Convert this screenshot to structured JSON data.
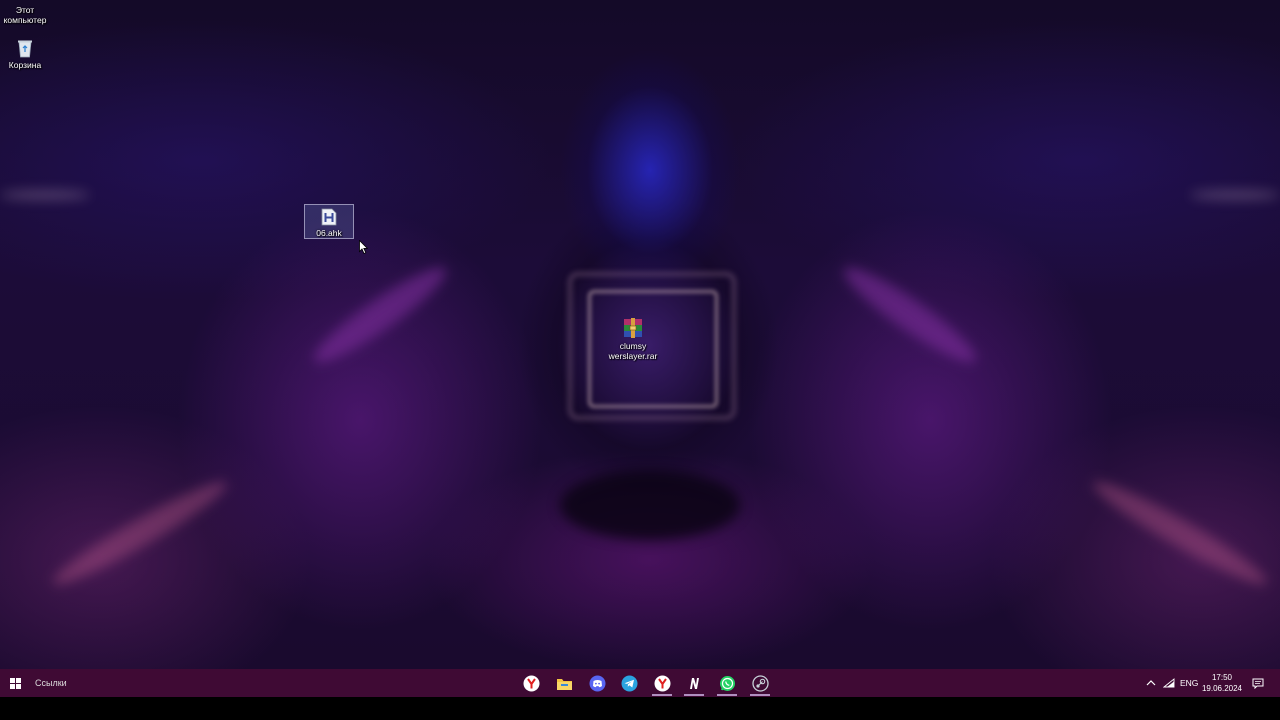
{
  "desktop": {
    "icons": [
      {
        "label_line1": "Этот",
        "label_line2": "компьютер"
      },
      {
        "label": "Корзина"
      },
      {
        "label": "06.ahk"
      },
      {
        "label_line1": "clumsy",
        "label_line2": "werslayer.rar"
      }
    ]
  },
  "taskbar": {
    "links_label": "Ссылки",
    "apps": [
      {
        "icon": "yandex-browser-icon",
        "color": "#ffffff"
      },
      {
        "icon": "file-explorer-icon",
        "color": "#f4c542"
      },
      {
        "icon": "discord-icon",
        "color": "#5865f2"
      },
      {
        "icon": "telegram-icon",
        "color": "#2aa3e0"
      },
      {
        "icon": "yandex-browser-icon",
        "color": "#ffffff"
      },
      {
        "icon": "notion-icon",
        "color": "#ffffff"
      },
      {
        "icon": "whatsapp-icon",
        "color": "#25d366"
      },
      {
        "icon": "steam-icon",
        "color": "#c7d0d8"
      }
    ],
    "tray": {
      "language": "ENG",
      "time": "17:50",
      "date": "19.06.2024"
    }
  },
  "colors": {
    "taskbar_bg": "#3f0a34",
    "wallpaper_dark": "#1a0a2e",
    "accent_purple": "#8a2aa8"
  }
}
